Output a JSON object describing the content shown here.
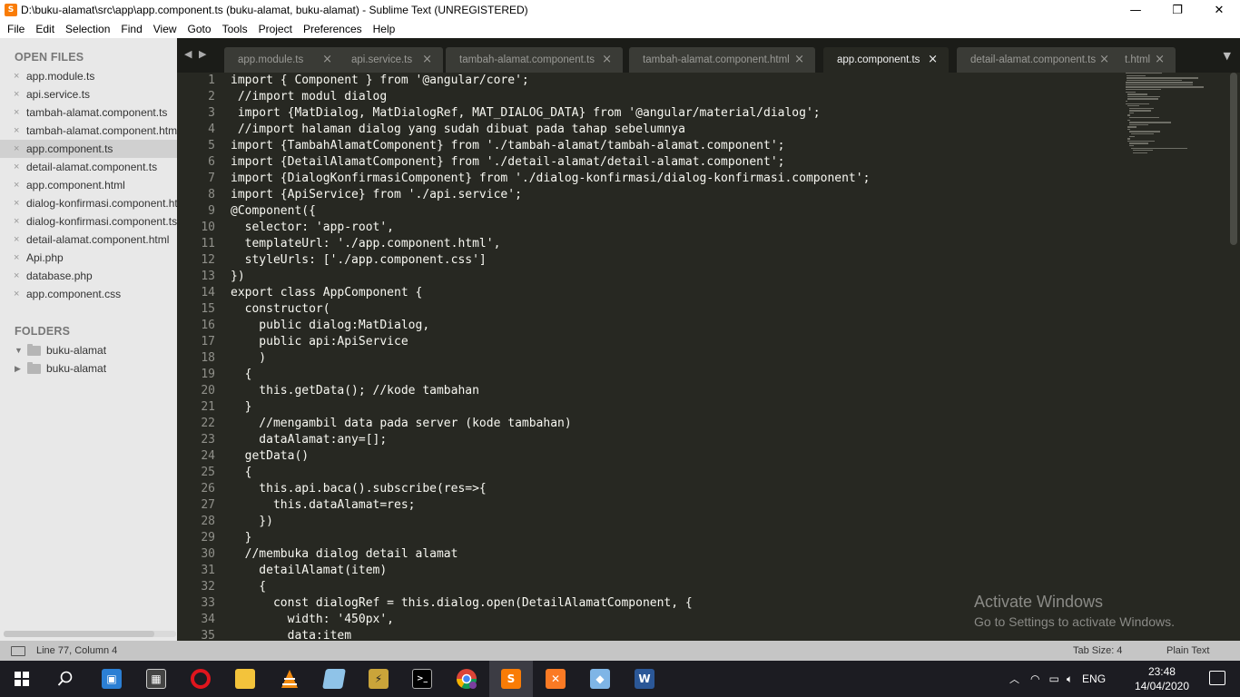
{
  "window": {
    "title": "D:\\buku-alamat\\src\\app\\app.component.ts (buku-alamat, buku-alamat) - Sublime Text (UNREGISTERED)",
    "minimize": "—",
    "maximize": "❐",
    "close": "✕"
  },
  "menu": [
    "File",
    "Edit",
    "Selection",
    "Find",
    "View",
    "Goto",
    "Tools",
    "Project",
    "Preferences",
    "Help"
  ],
  "sidebar": {
    "open_files_heading": "OPEN FILES",
    "open_files": [
      "app.module.ts",
      "api.service.ts",
      "tambah-alamat.component.ts",
      "tambah-alamat.component.html",
      "app.component.ts",
      "detail-alamat.component.ts",
      "app.component.html",
      "dialog-konfirmasi.component.html",
      "dialog-konfirmasi.component.ts",
      "detail-alamat.component.html",
      "Api.php",
      "database.php",
      "app.component.css"
    ],
    "active_index": 4,
    "folders_heading": "FOLDERS",
    "folders": [
      "buku-alamat",
      "buku-alamat"
    ],
    "close_glyph": "×"
  },
  "tabs": [
    {
      "label": "app.module.ts"
    },
    {
      "label": "api.service.ts"
    },
    {
      "label": "tambah-alamat.component.ts"
    },
    {
      "label": "tambah-alamat.component.html"
    },
    {
      "label": "app.component.ts"
    },
    {
      "label": "detail-alamat.component.ts"
    },
    {
      "label": "t.html"
    }
  ],
  "active_tab": 4,
  "tab_nav": "◀ ▶",
  "tab_overflow": "▼",
  "editor": {
    "line_numbers": [
      "1",
      "2",
      "3",
      "4",
      "5",
      "6",
      "7",
      "8",
      "9",
      "10",
      "11",
      "12",
      "13",
      "14",
      "15",
      "16",
      "17",
      "18",
      "19",
      "20",
      "21",
      "22",
      "23",
      "24",
      "25",
      "26",
      "27",
      "28",
      "29",
      "30",
      "31",
      "32",
      "33",
      "34",
      "35"
    ],
    "lines": [
      "import { Component } from '@angular/core';",
      " //import modul dialog",
      " import {MatDialog, MatDialogRef, MAT_DIALOG_DATA} from '@angular/material/dialog';",
      " //import halaman dialog yang sudah dibuat pada tahap sebelumnya",
      "import {TambahAlamatComponent} from './tambah-alamat/tambah-alamat.component';",
      "import {DetailAlamatComponent} from './detail-alamat/detail-alamat.component';",
      "import {DialogKonfirmasiComponent} from './dialog-konfirmasi/dialog-konfirmasi.component';",
      "import {ApiService} from './api.service';",
      "@Component({",
      "  selector: 'app-root',",
      "  templateUrl: './app.component.html',",
      "  styleUrls: ['./app.component.css']",
      "})",
      "export class AppComponent {",
      "  constructor(",
      "    public dialog:MatDialog,",
      "    public api:ApiService",
      "    )",
      "  {",
      "    this.getData(); //kode tambahan",
      "  }",
      "    //mengambil data pada server (kode tambahan)",
      "    dataAlamat:any=[];",
      "  getData()",
      "  {",
      "    this.api.baca().subscribe(res=>{",
      "      this.dataAlamat=res;",
      "    })",
      "  }",
      "  //membuka dialog detail alamat",
      "    detailAlamat(item)",
      "    {",
      "      const dialogRef = this.dialog.open(DetailAlamatComponent, {",
      "        width: '450px',",
      "        data:item"
    ]
  },
  "watermark": {
    "title": "Activate Windows",
    "subtitle": "Go to Settings to activate Windows."
  },
  "status": {
    "position": "Line 77, Column 4",
    "tab_size": "Tab Size: 4",
    "syntax": "Plain Text"
  },
  "taskbar": {
    "apps": [
      {
        "name": "start-icon"
      },
      {
        "name": "search-icon"
      },
      {
        "name": "computer-icon"
      },
      {
        "name": "video-editor-icon"
      },
      {
        "name": "opera-icon"
      },
      {
        "name": "file-explorer-icon"
      },
      {
        "name": "vlc-icon"
      },
      {
        "name": "notepad-icon"
      },
      {
        "name": "winamp-icon"
      },
      {
        "name": "terminal-icon"
      },
      {
        "name": "chrome-icon"
      },
      {
        "name": "sublime-icon"
      },
      {
        "name": "xampp-icon"
      },
      {
        "name": "virtualbox-icon"
      },
      {
        "name": "word-icon"
      }
    ],
    "lang": "ENG",
    "time": "23:48",
    "date": "14/04/2020"
  },
  "colors": {
    "editor_bg": "#272822",
    "sidebar_bg": "#e8e8e8",
    "tab_active": "#272822",
    "accent": "#f97c06"
  }
}
